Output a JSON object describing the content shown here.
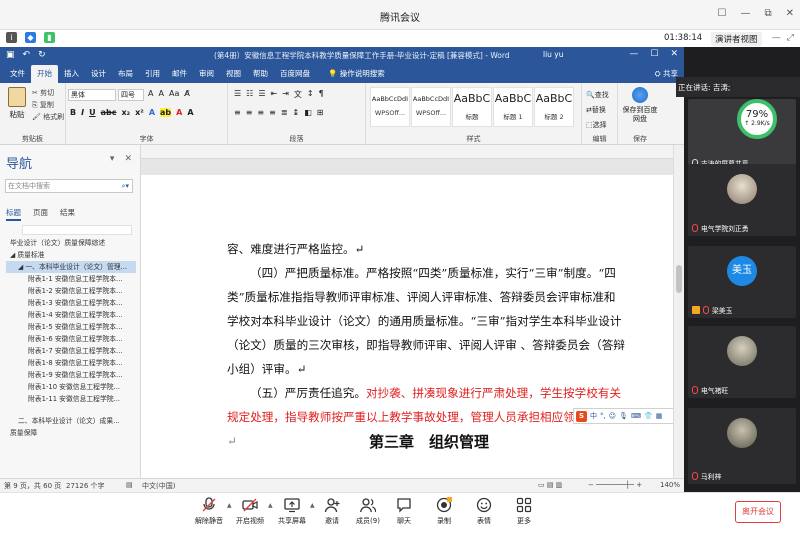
{
  "meeting": {
    "title": "腾讯会议",
    "timer": "01:38:14",
    "speaker_view": "演讲者视图",
    "speaking_now": "正在讲话: 吉涛;",
    "window_controls": [
      "☐",
      "—",
      "⧉",
      "✕"
    ]
  },
  "word": {
    "doc_title": "(第4册）安徽信息工程学院本科教学质量保障工作手册-毕业设计-定稿 [兼容模式] - Word",
    "user": "liu yu",
    "share": "共享",
    "tabs": [
      "文件",
      "开始",
      "插入",
      "设计",
      "布局",
      "引用",
      "邮件",
      "审阅",
      "视图",
      "帮助",
      "百度网盘"
    ],
    "active_tab": "开始",
    "tell_me": "操作说明搜索",
    "ribbon": {
      "paste": "粘贴",
      "cut": "剪切",
      "copy": "复制",
      "format_painter": "格式刷",
      "font_name": "黑体",
      "font_size": "四号",
      "group_clipboard": "剪贴板",
      "group_font": "字体",
      "group_paragraph": "段落",
      "group_styles": "样式",
      "group_editing": "编辑",
      "group_save": "保存",
      "styles": [
        {
          "sample": "AaBbCcDdI",
          "name": "WPSOff..."
        },
        {
          "sample": "AaBbCcDdI",
          "name": "WPSOff..."
        },
        {
          "sample": "AaBbC",
          "name": "标题"
        },
        {
          "sample": "AaBbC",
          "name": "标题 1"
        },
        {
          "sample": "AaBbC",
          "name": "标题 2"
        }
      ],
      "find": "查找",
      "replace": "替换",
      "select": "选择",
      "save_to_baidu": "保存到百度网盘"
    },
    "nav": {
      "title": "导航",
      "search_placeholder": "在文档中搜索",
      "tabs": [
        "标题",
        "页面",
        "结果"
      ],
      "items": [
        {
          "text": "毕业设计（论文）质量保障综述",
          "level": 0,
          "hl": false
        },
        {
          "text": "◢ 质量标准",
          "level": 0,
          "hl": false
        },
        {
          "text": "◢ 一、本科毕业设计（论文）管理...",
          "level": 1,
          "hl": true
        },
        {
          "text": "附表1-1 安徽信息工程学院本...",
          "level": 2,
          "hl": false
        },
        {
          "text": "附表1-2 安徽信息工程学院本...",
          "level": 2,
          "hl": false
        },
        {
          "text": "附表1-3 安徽信息工程学院本...",
          "level": 2,
          "hl": false
        },
        {
          "text": "附表1-4 安徽信息工程学院本...",
          "level": 2,
          "hl": false
        },
        {
          "text": "附表1-5 安徽信息工程学院本...",
          "level": 2,
          "hl": false
        },
        {
          "text": "附表1-6 安徽信息工程学院本...",
          "level": 2,
          "hl": false
        },
        {
          "text": "附表1-7 安徽信息工程学院本...",
          "level": 2,
          "hl": false
        },
        {
          "text": "附表1-8 安徽信息工程学院本...",
          "level": 2,
          "hl": false
        },
        {
          "text": "附表1-9 安徽信息工程学院本...",
          "level": 2,
          "hl": false
        },
        {
          "text": "附表1-10 安徽信息工程学院...",
          "level": 2,
          "hl": false
        },
        {
          "text": "附表1-11 安徽信息工程学院...",
          "level": 2,
          "hl": false
        },
        {
          "text": "二、本科毕业设计（论文）成果...",
          "level": 1,
          "hl": false
        },
        {
          "text": "质量保障",
          "level": 0,
          "hl": false
        }
      ]
    },
    "document": {
      "line0": "容、难度进行严格监控。↵",
      "para4": "（四）严把质量标准。严格按照“四类”质量标准，实行“三审”制度。“四类”质量标准指指导教师评审标准、评阅人评审标准、答辩委员会评审标准和学校对本科毕业设计（论文）的通用质量标准。“三审”指对学生本科毕业设计（论文）质量的三次审核，即指导教师评审、评阅人评审 、答辩委员会（答辩小组）评审。↵",
      "para5_black": "（五）严厉责任追究。",
      "para5_red": "对抄袭、拼凑现象进行严肃处理，学生按学校有关规定处理，指导教师按严重以上教学事故处理，管理人员承担相应领导责任。",
      "para5_end": "↵",
      "heading_cut": "第三章　组织管理"
    },
    "statusbar": {
      "page": "第 9 页，共 60 页",
      "words": "27126 个字",
      "lang": "中文(中国)",
      "zoom": "140%"
    }
  },
  "participants": [
    {
      "name": "吉涛的屏幕共享",
      "mic": "on",
      "percent": "79%",
      "rate": "↑ 2.9K/s"
    },
    {
      "name": "电气学院刘正勇",
      "mic": "off"
    },
    {
      "name": "梁美玉",
      "mic": "off",
      "avatar_text": "美玉"
    },
    {
      "name": "电气褚旺",
      "mic": "off"
    },
    {
      "name": "马利梓",
      "mic": "off"
    }
  ],
  "toolbar": {
    "items": [
      "解除静音",
      "开启视频",
      "共享屏幕",
      "邀请",
      "成员(9)",
      "聊天",
      "录制",
      "表情",
      "更多"
    ],
    "leave": "离开会议"
  },
  "colors": {
    "word_blue": "#2b579a",
    "red_text": "#e02020",
    "leave_red": "#e04040",
    "ring_green": "#3cc06a"
  }
}
